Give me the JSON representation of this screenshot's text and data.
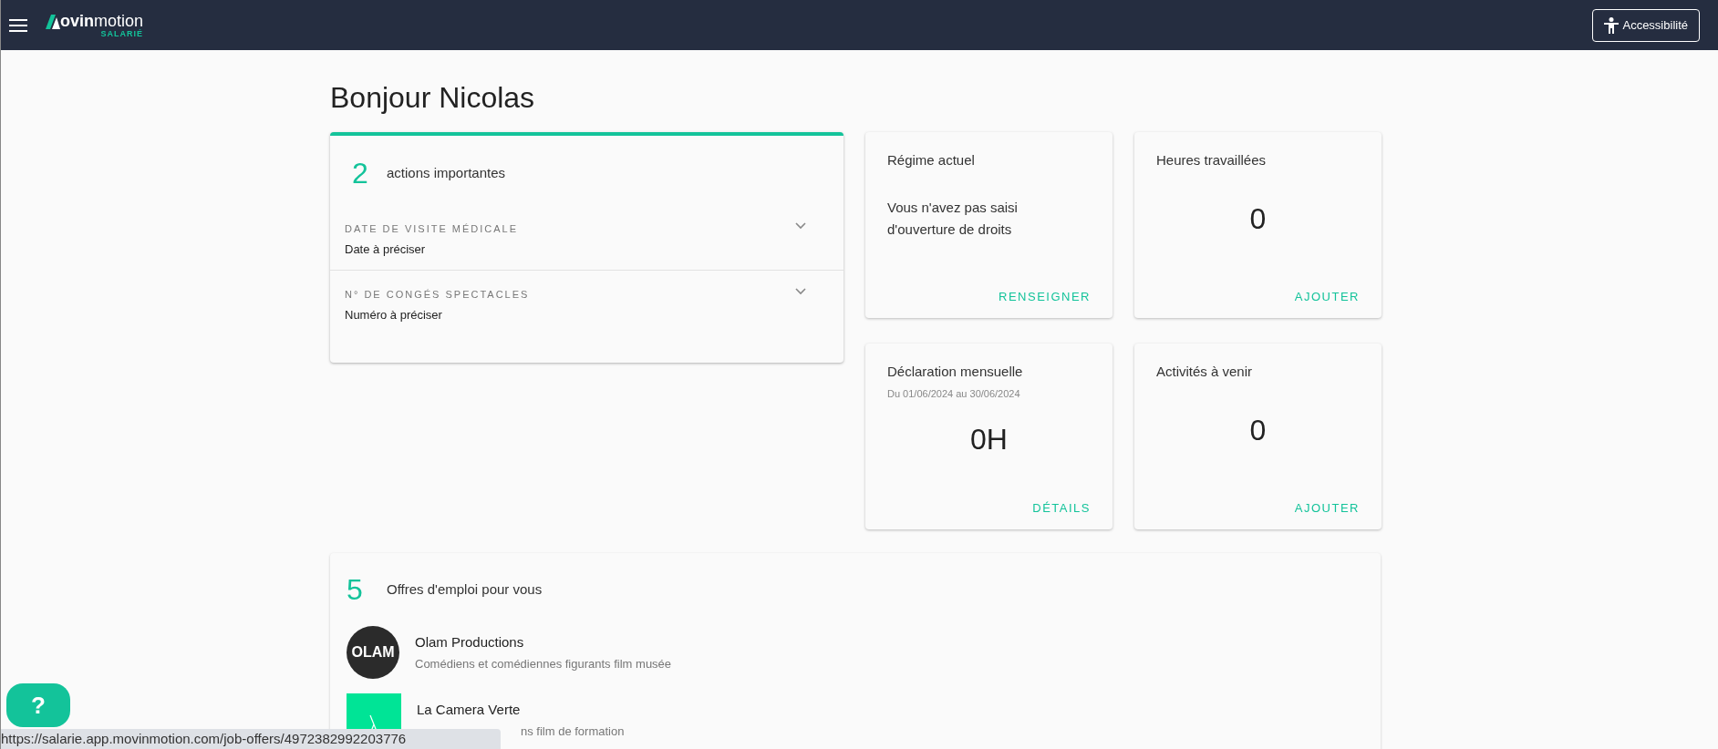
{
  "header": {
    "logo": {
      "bold": "ovin",
      "light": "motion",
      "sub": "SALARIÉ"
    },
    "accessibility_button": "Accessibilité"
  },
  "greeting": "Bonjour Nicolas",
  "actions": {
    "count": "2",
    "label": "actions importantes",
    "items": [
      {
        "title": "DATE DE VISITE MÉDICALE",
        "value": "Date à préciser",
        "expanded": false
      },
      {
        "title": "N° DE CONGÉS SPECTACLES",
        "value": "Numéro à préciser",
        "expanded": false
      }
    ]
  },
  "cards": [
    {
      "kind": "text",
      "title": "Régime actuel",
      "body": "Vous n'avez pas saisi d'ouverture de droits",
      "action": "RENSEIGNER"
    },
    {
      "kind": "value",
      "title": "Heures travaillées",
      "value": "0",
      "action": "AJOUTER"
    },
    {
      "kind": "value",
      "title": "Déclaration mensuelle",
      "subtitle": "Du 01/06/2024 au 30/06/2024",
      "value": "0H",
      "action": "DÉTAILS"
    },
    {
      "kind": "value",
      "title": "Activités à venir",
      "value": "0",
      "action": "AJOUTER"
    }
  ],
  "jobs": {
    "count": "5",
    "label": "Offres d'emploi pour vous",
    "items": [
      {
        "kind": "round",
        "logo_text": "OLAM",
        "company": "Olam Productions",
        "description": "Comédiens et comédiennes figurants film musée",
        "clipped": false
      },
      {
        "kind": "square",
        "company": "La Camera Verte",
        "description": "ns film de formation",
        "clipped": true
      }
    ]
  },
  "help_button": "?",
  "status_bar": "https://salarie.app.movinmotion.com/job-offers/4972382992203776"
}
